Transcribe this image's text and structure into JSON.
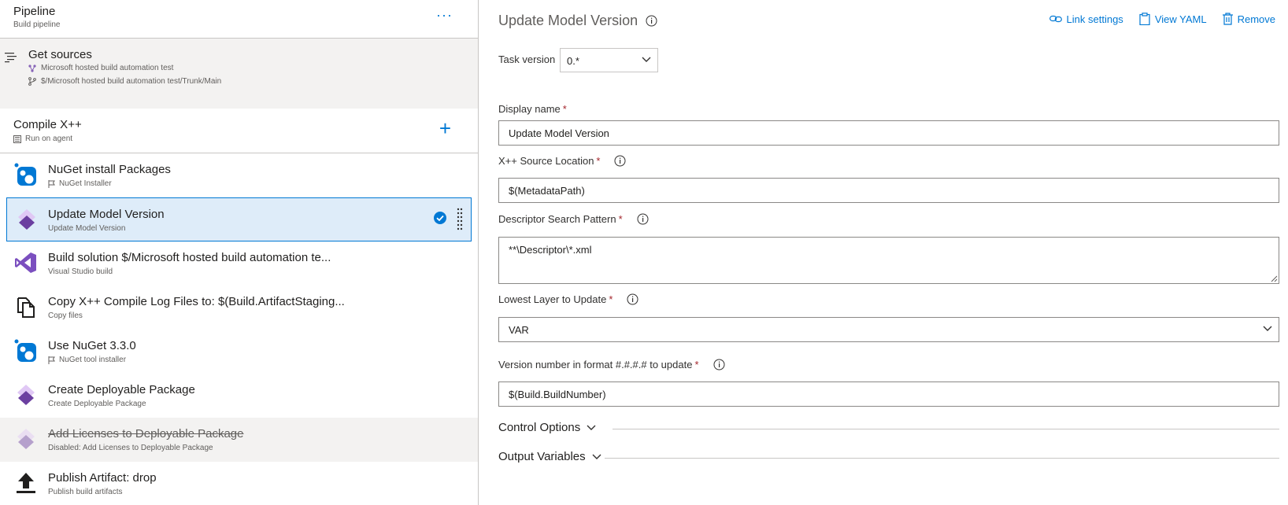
{
  "pipeline": {
    "title": "Pipeline",
    "subtitle": "Build pipeline",
    "more": "···"
  },
  "sources": {
    "title": "Get sources",
    "repo": "Microsoft hosted build automation test",
    "path": "$/Microsoft hosted build automation test/Trunk/Main"
  },
  "phase": {
    "title": "Compile X++",
    "subtitle": "Run on agent",
    "add": "+"
  },
  "tasks": [
    {
      "name": "NuGet install Packages",
      "sub": "NuGet Installer",
      "icon": "nuget-icon"
    },
    {
      "name": "Update Model Version",
      "sub": "Update Model Version",
      "icon": "dynamics-icon"
    },
    {
      "name": "Build solution $/Microsoft hosted build automation te...",
      "sub": "Visual Studio build",
      "icon": "visual-studio-icon"
    },
    {
      "name": "Copy X++ Compile Log Files to: $(Build.ArtifactStaging...",
      "sub": "Copy files",
      "icon": "copy-files-icon"
    },
    {
      "name": "Use NuGet 3.3.0",
      "sub": "NuGet tool installer",
      "icon": "nuget-icon"
    },
    {
      "name": "Create Deployable Package",
      "sub": "Create Deployable Package",
      "icon": "dynamics-icon"
    },
    {
      "name": "Add Licenses to Deployable Package",
      "sub": "Disabled: Add Licenses to Deployable Package",
      "icon": "dynamics-icon"
    },
    {
      "name": "Publish Artifact: drop",
      "sub": "Publish build artifacts",
      "icon": "upload-icon"
    }
  ],
  "detail": {
    "title": "Update Model Version",
    "actions": {
      "link_settings": "Link settings",
      "view_yaml": "View YAML",
      "remove": "Remove"
    },
    "task_version_label": "Task version",
    "task_version_value": "0.*",
    "display_name_label": "Display name",
    "display_name_value": "Update Model Version",
    "source_location_label": "X++ Source Location",
    "source_location_value": "$(MetadataPath)",
    "descriptor_label": "Descriptor Search Pattern",
    "descriptor_value": "**\\Descriptor\\*.xml",
    "lowest_layer_label": "Lowest Layer to Update",
    "lowest_layer_value": "VAR",
    "version_label": "Version number in format #.#.#.# to update",
    "version_value": "$(Build.BuildNumber)",
    "required_mark": "*",
    "control_options": "Control Options",
    "output_variables": "Output Variables"
  },
  "colors": {
    "accent": "#0078d4",
    "selected_bg": "#deecf9",
    "required": "#a4262c"
  }
}
